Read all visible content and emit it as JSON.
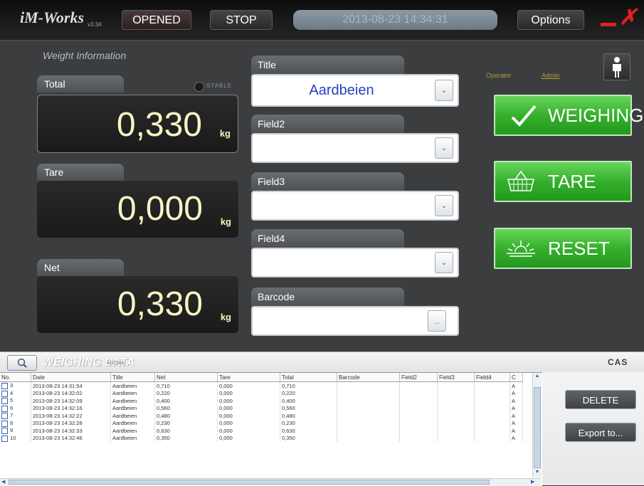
{
  "topbar": {
    "logo": "iM-Works",
    "version": "v3.34",
    "opened_label": "OPENED",
    "stop_label": "STOP",
    "datetime": "2013-08-23 14:34:31",
    "options_label": "Options"
  },
  "weight": {
    "section_title": "Weight Information",
    "stable_label": "STABLE",
    "total_label": "Total",
    "total_value": "0,330",
    "tare_label": "Tare",
    "tare_value": "0,000",
    "net_label": "Net",
    "net_value": "0,330",
    "unit": "kg"
  },
  "fields": {
    "title_label": "Title",
    "title_value": "Aardbeien",
    "field2_label": "Field2",
    "field3_label": "Field3",
    "field4_label": "Field4",
    "barcode_label": "Barcode",
    "barcode_button": "..."
  },
  "operator": {
    "label": "Operator",
    "value": "Admin"
  },
  "actions": {
    "weighing": "WEIGHING",
    "tare": "TARE",
    "reset": "RESET"
  },
  "data_section": {
    "title": "WEIGHING DATA",
    "subtitle": "All Data",
    "brand": "CAS",
    "delete_label": "DELETE",
    "export_label": "Export to..."
  },
  "table": {
    "columns": [
      "No.",
      "Date",
      "Title",
      "Net",
      "Tare",
      "Total",
      "Barcode",
      "Field2",
      "Field3",
      "Field4",
      "C"
    ],
    "rows": [
      [
        "3",
        "2013-08-23 14:31:54",
        "Aardbeien",
        "0,710",
        "0,000",
        "0,710",
        "",
        "",
        "",
        "",
        "A"
      ],
      [
        "4",
        "2013-08-23 14:32:02",
        "Aardbeien",
        "0,220",
        "0,000",
        "0,220",
        "",
        "",
        "",
        "",
        "A"
      ],
      [
        "5",
        "2013-08-23 14:32:09",
        "Aardbeien",
        "0,400",
        "0,000",
        "0,400",
        "",
        "",
        "",
        "",
        "A"
      ],
      [
        "6",
        "2013-08-23 14:32:16",
        "Aardbeien",
        "0,560",
        "0,000",
        "0,560",
        "",
        "",
        "",
        "",
        "A"
      ],
      [
        "7",
        "2013-08-23 14:32:22",
        "Aardbeien",
        "0,480",
        "0,000",
        "0,480",
        "",
        "",
        "",
        "",
        "A"
      ],
      [
        "8",
        "2013-08-23 14:32:28",
        "Aardbeien",
        "0,230",
        "0,000",
        "0,230",
        "",
        "",
        "",
        "",
        "A"
      ],
      [
        "9",
        "2013-08-23 14:32:33",
        "Aardbeien",
        "0,630",
        "0,000",
        "0,630",
        "",
        "",
        "",
        "",
        "A"
      ],
      [
        "10",
        "2013-08-23 14:32:46",
        "Aardbeien",
        "0,350",
        "0,000",
        "0,350",
        "",
        "",
        "",
        "",
        "A"
      ]
    ]
  },
  "colors": {
    "accent_green": "#35b02c",
    "display_text": "#f7f4c3",
    "title_value_blue": "#2740c0",
    "close_red": "#e0201c"
  },
  "icons": {
    "check": "check-icon",
    "basket": "basket-icon",
    "sunrise": "sunrise-icon",
    "user": "user-icon",
    "search": "search-icon"
  }
}
